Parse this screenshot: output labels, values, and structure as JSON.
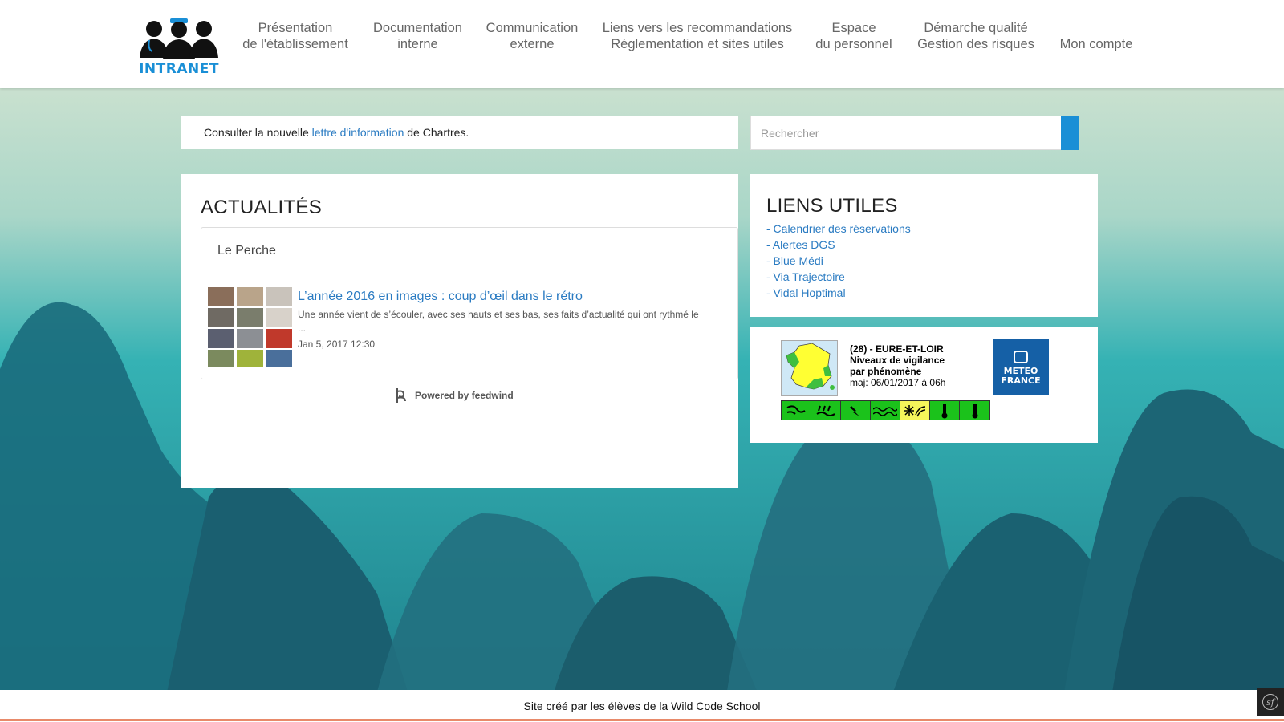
{
  "header": {
    "logo_text": "INTRANET",
    "nav": [
      {
        "line1": "Présentation",
        "line2": "de l'établissement"
      },
      {
        "line1": "Documentation",
        "line2": "interne"
      },
      {
        "line1": "Communication",
        "line2": "externe"
      },
      {
        "line1": "Liens vers les recommandations",
        "line2": "Réglementation et sites utiles"
      },
      {
        "line1": "Espace",
        "line2": "du personnel"
      },
      {
        "line1": "Démarche qualité",
        "line2": "Gestion des risques"
      },
      {
        "line1": "Mon compte",
        "line2": ""
      }
    ]
  },
  "notice": {
    "prefix": "Consulter la nouvelle ",
    "link": "lettre d'information",
    "suffix": " de Chartres."
  },
  "search": {
    "placeholder": "Rechercher"
  },
  "news": {
    "title": "ACTUALITÉS",
    "feed_title": "Le Perche",
    "entry": {
      "title": "L’année 2016 en images : coup d’œil dans le rétro",
      "description": "Une année vient de s’écouler, avec ses hauts et ses bas, ses faits d’actualité qui ont rythmé le ...",
      "date": "Jan 5, 2017 12:30"
    },
    "powered_by": "Powered by feedwind"
  },
  "links": {
    "title": "LIENS UTILES",
    "items": [
      "- Calendrier des réservations",
      "- Alertes DGS",
      "- Blue Médi",
      "- Via Trajectoire",
      "- Vidal Hoptimal"
    ]
  },
  "weather": {
    "department": "(28) - EURE-ET-LOIR",
    "line2": "Niveaux de vigilance",
    "line3": "par phénomène",
    "updated": "maj: 06/01/2017 à 06h",
    "logo_line1": "METEO",
    "logo_line2": "FRANCE",
    "phenomena": [
      {
        "icon": "wind-icon",
        "level_color": "#1bc21b"
      },
      {
        "icon": "rain-flood-icon",
        "level_color": "#1bc21b"
      },
      {
        "icon": "thunderstorm-icon",
        "level_color": "#1bc21b"
      },
      {
        "icon": "flood-icon",
        "level_color": "#1bc21b"
      },
      {
        "icon": "snow-ice-icon",
        "level_color": "#f5f55a"
      },
      {
        "icon": "heat-icon",
        "level_color": "#1bc21b"
      },
      {
        "icon": "cold-icon",
        "level_color": "#1bc21b"
      }
    ]
  },
  "footer": {
    "text": "Site créé par les élèves de la Wild Code School"
  },
  "colors": {
    "accent": "#1a8fd6",
    "link": "#2a7bc2",
    "footer_line": "#e88a6a"
  }
}
